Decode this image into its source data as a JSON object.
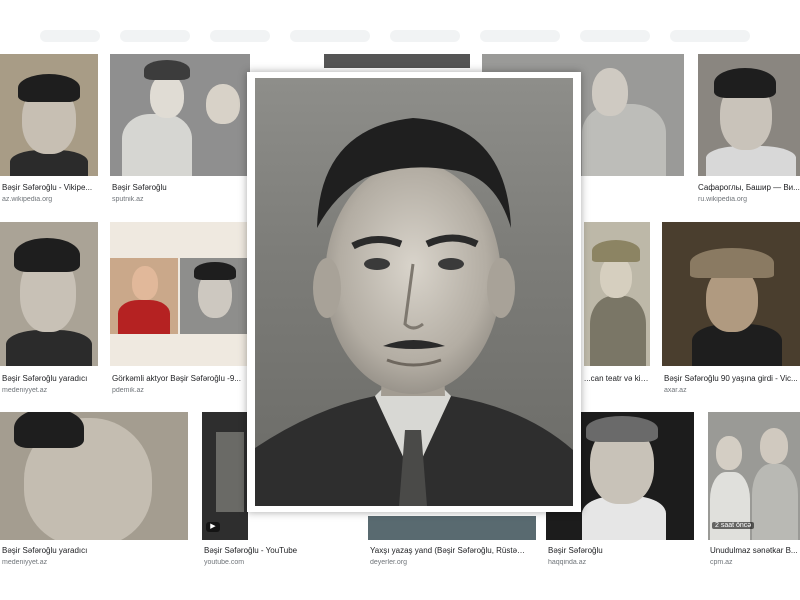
{
  "results": [
    {
      "caption": "Bəşir Səfəroğlu - Vikipe...",
      "source": "az.wikipedia.org"
    },
    {
      "caption": "Bəşir Səfəroğlu",
      "source": "sputnik.az"
    },
    {
      "caption": "Сафароглы, Башир — Ви...",
      "source": "ru.wikipedia.org"
    },
    {
      "caption": "Bəşir Səfəroğlu yaradıcı",
      "source": "medeniyyet.az"
    },
    {
      "caption": "Görkəmli aktyor Bəşir Səfəroğlu -9...",
      "source": "pdemik.az"
    },
    {
      "caption": "...can teatr və kin...",
      "source": ""
    },
    {
      "caption": "Bəşir Səfəroğlu 90 yaşına girdi - Vic...",
      "source": "axar.az"
    },
    {
      "caption": "Bəşir Səfəroğlu yaradıcı",
      "source": "medeniyyet.az"
    },
    {
      "caption": "Bəşir Səfəroğlu - YouTube",
      "source": "youtube.com"
    },
    {
      "caption": "Yaxşı yazaş yand (Bəşir Səfəroğlu, Rüstəm...",
      "source": "deyerler.org"
    },
    {
      "caption": "Bəşir Səfəroğlu",
      "source": "haqqinda.az"
    },
    {
      "caption": "Unudulmaz sənətkar B...",
      "source": "cpm.az"
    }
  ],
  "video_badges": {
    "play": "▶",
    "duration": "2 saat öncə"
  },
  "overlay": {
    "alt": "Bəşir Səfəroğlu portrait"
  }
}
